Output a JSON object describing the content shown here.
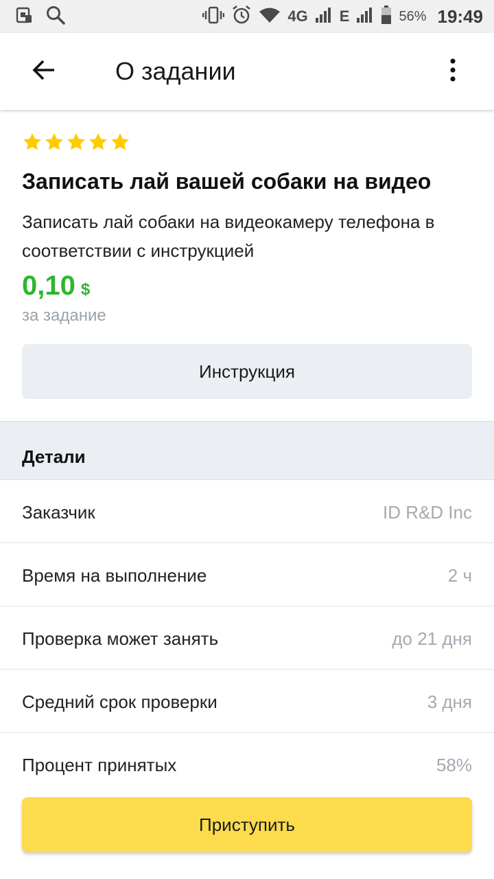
{
  "status_bar": {
    "network": "4G",
    "network2": "E",
    "battery": "56%",
    "time": "19:49",
    "icons": [
      "sim-card-icon",
      "search-icon",
      "vibrate-icon",
      "alarm-icon",
      "wifi-icon",
      "signal-icon",
      "signal-icon-2",
      "battery-icon"
    ]
  },
  "app_bar": {
    "title": "О задании",
    "back_icon": "arrow-back-icon",
    "more_icon": "more-vert-icon"
  },
  "task": {
    "rating_stars": 5,
    "rating_max": 5,
    "star_color": "#ffcc00",
    "title": "Записать лай вашей собаки на видео",
    "description": "Записать лай собаки на видеокамеру телефона в соответствии с инструкцией",
    "price": "0,10",
    "currency": "$",
    "price_color": "#2fb530",
    "price_note": "за задание",
    "instruction_button": "Инструкция"
  },
  "details": {
    "title": "Детали",
    "rows": [
      {
        "label": "Заказчик",
        "value": "ID R&D Inc"
      },
      {
        "label": "Время на выполнение",
        "value": "2 ч"
      },
      {
        "label": "Проверка может занять",
        "value": "до 21 дня"
      },
      {
        "label": "Средний срок проверки",
        "value": "3 дня"
      },
      {
        "label": "Процент принятых",
        "value": "58%"
      }
    ]
  },
  "start_button": {
    "label": "Приступить",
    "color": "#fcdb4d"
  }
}
